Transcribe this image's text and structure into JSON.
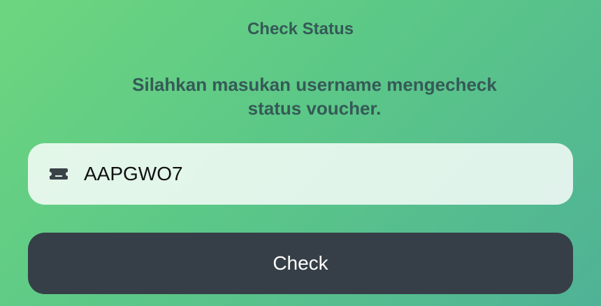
{
  "page": {
    "title": "Check Status",
    "subtitle": "Silahkan masukan username mengecheck status voucher."
  },
  "form": {
    "username_input": {
      "value": "AAPGWO7",
      "icon": "ticket-icon"
    },
    "check_button": {
      "label": "Check"
    }
  },
  "colors": {
    "heading_text": "#355a57",
    "button_bg": "#363f47",
    "button_text": "#ffffff",
    "gradient_start": "#6dd67f",
    "gradient_end": "#4fb296"
  }
}
